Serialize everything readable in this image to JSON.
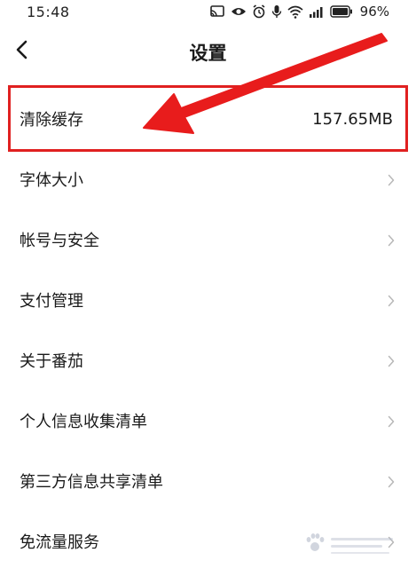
{
  "status_bar": {
    "time": "15:48",
    "battery_percent": "96%",
    "icons": [
      "cast-icon",
      "eye-icon",
      "alarm-icon",
      "mic-icon",
      "wifi-icon",
      "signal-icon",
      "battery-icon"
    ]
  },
  "header": {
    "title": "设置",
    "back_icon": "chevron-left-icon"
  },
  "settings": {
    "items": [
      {
        "label": "清除缓存",
        "value": "157.65MB"
      },
      {
        "label": "字体大小"
      },
      {
        "label": "帐号与安全"
      },
      {
        "label": "支付管理"
      },
      {
        "label": "关于番茄"
      },
      {
        "label": "个人信息收集清单"
      },
      {
        "label": "第三方信息共享清单"
      },
      {
        "label": "免流量服务"
      }
    ]
  },
  "annotation": {
    "highlight_color": "#e02020",
    "arrow_color": "#e81c1c"
  },
  "watermark": {
    "icon": "baidu-paw-icon"
  }
}
